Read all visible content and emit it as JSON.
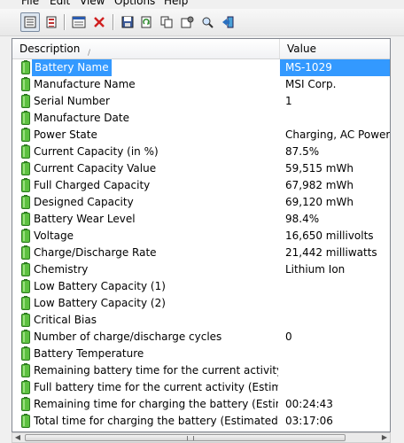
{
  "menu": [
    "File",
    "Edit",
    "View",
    "Options",
    "Help"
  ],
  "toolbar": {
    "icons": [
      "html-report-icon",
      "text-report-icon",
      "properties-icon",
      "delete-icon",
      "save-icon",
      "refresh-icon",
      "copy-icon",
      "options-icon",
      "find-icon",
      "exit-icon"
    ]
  },
  "header": {
    "description": "Description",
    "value": "Value"
  },
  "rows": [
    {
      "label": "Battery Name",
      "value": "MS-1029",
      "selected": true
    },
    {
      "label": "Manufacture Name",
      "value": "MSI Corp."
    },
    {
      "label": "Serial Number",
      "value": "1"
    },
    {
      "label": "Manufacture Date",
      "value": ""
    },
    {
      "label": "Power State",
      "value": "Charging, AC Power"
    },
    {
      "label": "Current Capacity (in %)",
      "value": "87.5%"
    },
    {
      "label": "Current Capacity Value",
      "value": "59,515 mWh"
    },
    {
      "label": "Full Charged Capacity",
      "value": "67,982 mWh"
    },
    {
      "label": "Designed Capacity",
      "value": "69,120 mWh"
    },
    {
      "label": "Battery Wear Level",
      "value": "98.4%"
    },
    {
      "label": "Voltage",
      "value": "16,650 millivolts"
    },
    {
      "label": "Charge/Discharge Rate",
      "value": "21,442 milliwatts"
    },
    {
      "label": "Chemistry",
      "value": "Lithium Ion"
    },
    {
      "label": "Low Battery Capacity (1)",
      "value": ""
    },
    {
      "label": "Low Battery Capacity (2)",
      "value": ""
    },
    {
      "label": "Critical Bias",
      "value": ""
    },
    {
      "label": "Number of charge/discharge cycles",
      "value": "0"
    },
    {
      "label": "Battery Temperature",
      "value": ""
    },
    {
      "label": "Remaining battery time for the current activity (Est...",
      "value": ""
    },
    {
      "label": "Full battery time for the current activity (Estimated)",
      "value": ""
    },
    {
      "label": "Remaining time for charging the battery (Estimated)",
      "value": "00:24:43"
    },
    {
      "label": "Total  time for charging the battery (Estimated)",
      "value": "03:17:06"
    }
  ],
  "colors": {
    "selection": "#3399ff",
    "battery": "#3a9a2a"
  }
}
